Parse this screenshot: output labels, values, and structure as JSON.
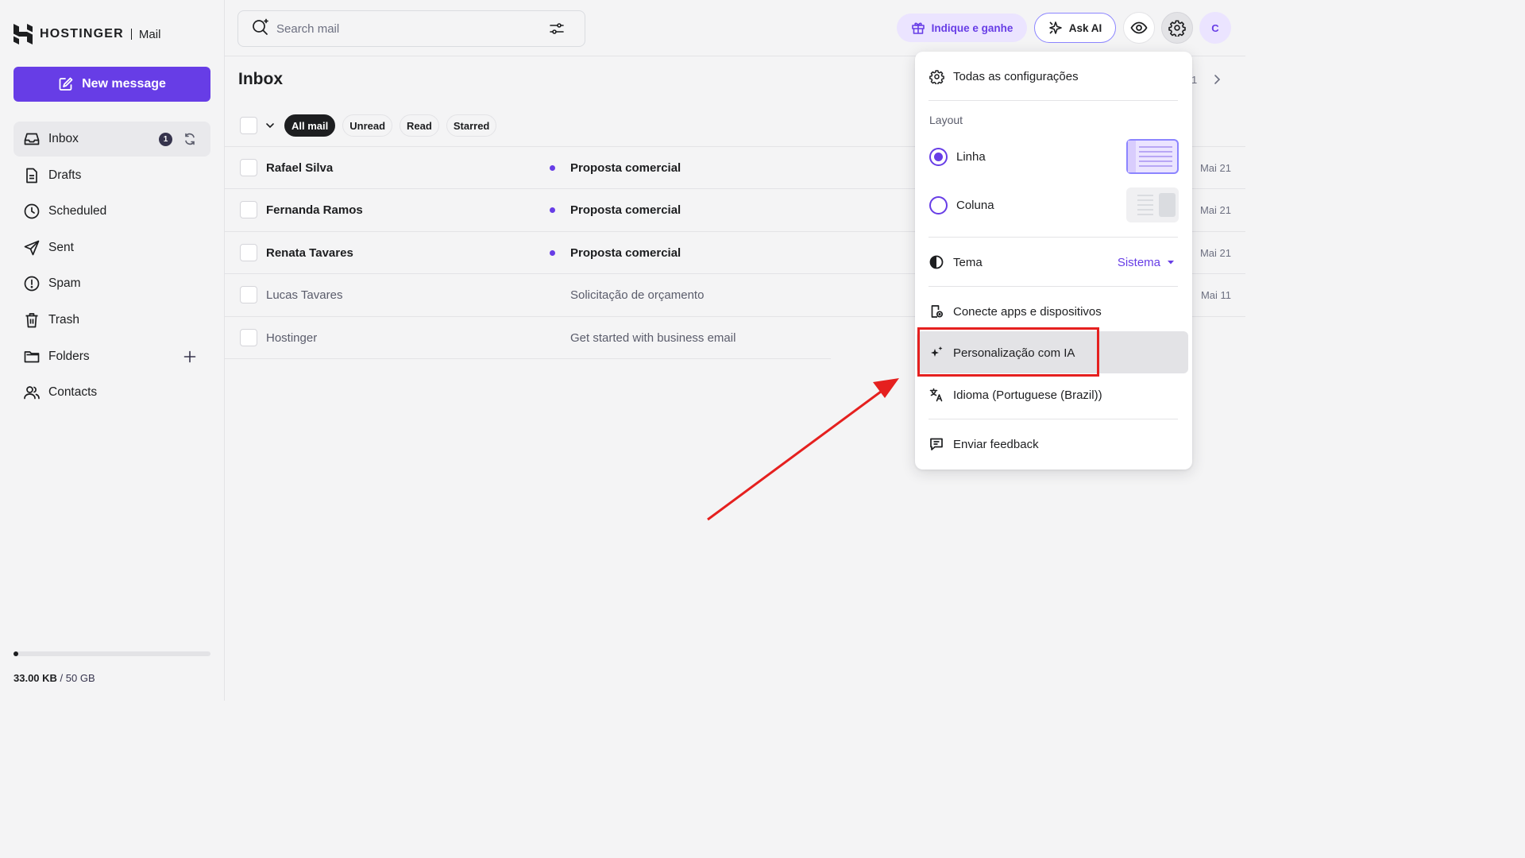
{
  "brand": {
    "name": "HOSTINGER",
    "product": "Mail"
  },
  "compose": {
    "label": "New message"
  },
  "sidebar": {
    "items": [
      {
        "label": "Inbox",
        "badge": "1"
      },
      {
        "label": "Drafts"
      },
      {
        "label": "Scheduled"
      },
      {
        "label": "Sent"
      },
      {
        "label": "Spam"
      },
      {
        "label": "Trash"
      },
      {
        "label": "Folders"
      },
      {
        "label": "Contacts"
      }
    ]
  },
  "storage": {
    "used": "33.00 KB",
    "total": "/ 50 GB",
    "fraction_used": 1e-06
  },
  "search": {
    "placeholder": "Search mail"
  },
  "topbar": {
    "refer_label": "Indique e ganhe",
    "ask_ai_label": "Ask AI",
    "avatar_initial": "C"
  },
  "inbox": {
    "title": "Inbox",
    "pager_number": "1",
    "filters": [
      "All mail",
      "Unread",
      "Read",
      "Starred"
    ],
    "active_filter": "All mail",
    "emails": [
      {
        "sender": "Rafael Silva",
        "subject": "Proposta comercial",
        "date": "Mai 21",
        "unread": true
      },
      {
        "sender": "Fernanda Ramos",
        "subject": "Proposta comercial",
        "date": "Mai 21",
        "unread": true
      },
      {
        "sender": "Renata Tavares",
        "subject": "Proposta comercial",
        "date": "Mai 21",
        "unread": true
      },
      {
        "sender": "Lucas Tavares",
        "subject": "Solicitação de orçamento",
        "date": "Mai 11",
        "unread": false
      },
      {
        "sender": "Hostinger",
        "subject": "Get started with business email",
        "date": "",
        "unread": false
      }
    ]
  },
  "settings_menu": {
    "all_settings": "Todas as configurações",
    "layout_label": "Layout",
    "layout_options": [
      {
        "label": "Linha",
        "selected": true
      },
      {
        "label": "Coluna",
        "selected": false
      }
    ],
    "theme_label": "Tema",
    "theme_value": "Sistema",
    "connect_apps": "Conecte apps e dispositivos",
    "ai_personalization": "Personalização com IA",
    "language": "Idioma (Portuguese (Brazil))",
    "feedback": "Enviar feedback"
  },
  "colors": {
    "accent": "#673de6",
    "accent_light": "#ebe4ff",
    "annotation_red": "#e5201f",
    "text_primary": "#1d1e20",
    "background": "#f4f4f5"
  }
}
